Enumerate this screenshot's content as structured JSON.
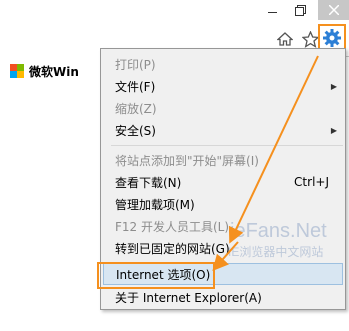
{
  "window": {
    "tab_title": "微软Win"
  },
  "toolbar": {
    "icons": [
      "home-icon",
      "star-icon",
      "gear-icon"
    ]
  },
  "menu": {
    "items": [
      {
        "label": "打印(P)",
        "shortcut": "",
        "submenu": false,
        "disabled": true
      },
      {
        "label": "文件(F)",
        "shortcut": "",
        "submenu": true,
        "disabled": false
      },
      {
        "label": "缩放(Z)",
        "shortcut": "",
        "submenu": false,
        "disabled": true
      },
      {
        "label": "安全(S)",
        "shortcut": "",
        "submenu": true,
        "disabled": false
      },
      {
        "label": "将站点添加到\"开始\"屏幕(I)",
        "shortcut": "",
        "submenu": false,
        "disabled": true
      },
      {
        "label": "查看下载(N)",
        "shortcut": "Ctrl+J",
        "submenu": false,
        "disabled": false
      },
      {
        "label": "管理加载项(M)",
        "shortcut": "",
        "submenu": false,
        "disabled": false
      },
      {
        "label": "F12 开发人员工具(L)",
        "shortcut": "",
        "submenu": false,
        "disabled": true
      },
      {
        "label": "转到已固定的网站(G)",
        "shortcut": "",
        "submenu": false,
        "disabled": false
      },
      {
        "label": "Internet 选项(O)",
        "shortcut": "",
        "submenu": false,
        "disabled": false
      },
      {
        "label": "关于 Internet Explorer(A)",
        "shortcut": "",
        "submenu": false,
        "disabled": false
      }
    ]
  },
  "watermark": {
    "line1": "ieFans.Net",
    "line2": "IE浏览器中文网站"
  },
  "colors": {
    "annotation": "#f5901e",
    "selected_bg": "#d8e6f2"
  }
}
